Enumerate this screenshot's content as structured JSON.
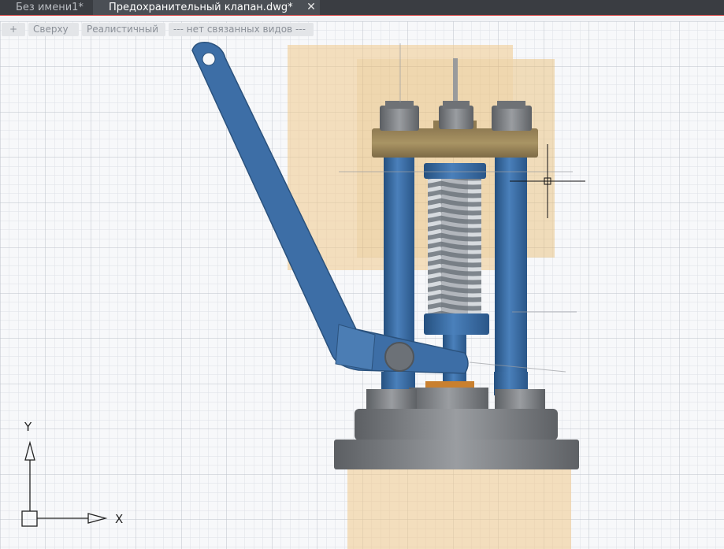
{
  "tabs": [
    {
      "label": "Без имени1*"
    },
    {
      "label": "Предохранительный клапан.dwg*",
      "active": true
    }
  ],
  "tab_close_symbol": "✕",
  "viewport_controls": {
    "plus": "+",
    "view": "Сверху",
    "visual_style": "Реалистичный",
    "views_link": "--- нет связанных видов ---"
  },
  "ucs": {
    "x_label": "X",
    "y_label": "Y"
  },
  "icons": {
    "tab_close": "close-icon",
    "ucs": "ucs-icon",
    "cursor": "crosshair-cursor-icon"
  },
  "colors": {
    "tab_bar": "#3a3d42",
    "grid_minor": "#dde1e7",
    "grid_major": "#b8bec7",
    "lever_blue": "#3d6ea6",
    "bronze": "#a08a5c",
    "steel": "#7a7d80",
    "transparent_orange": "#f0c98a",
    "spring": "#9aa2aa"
  }
}
